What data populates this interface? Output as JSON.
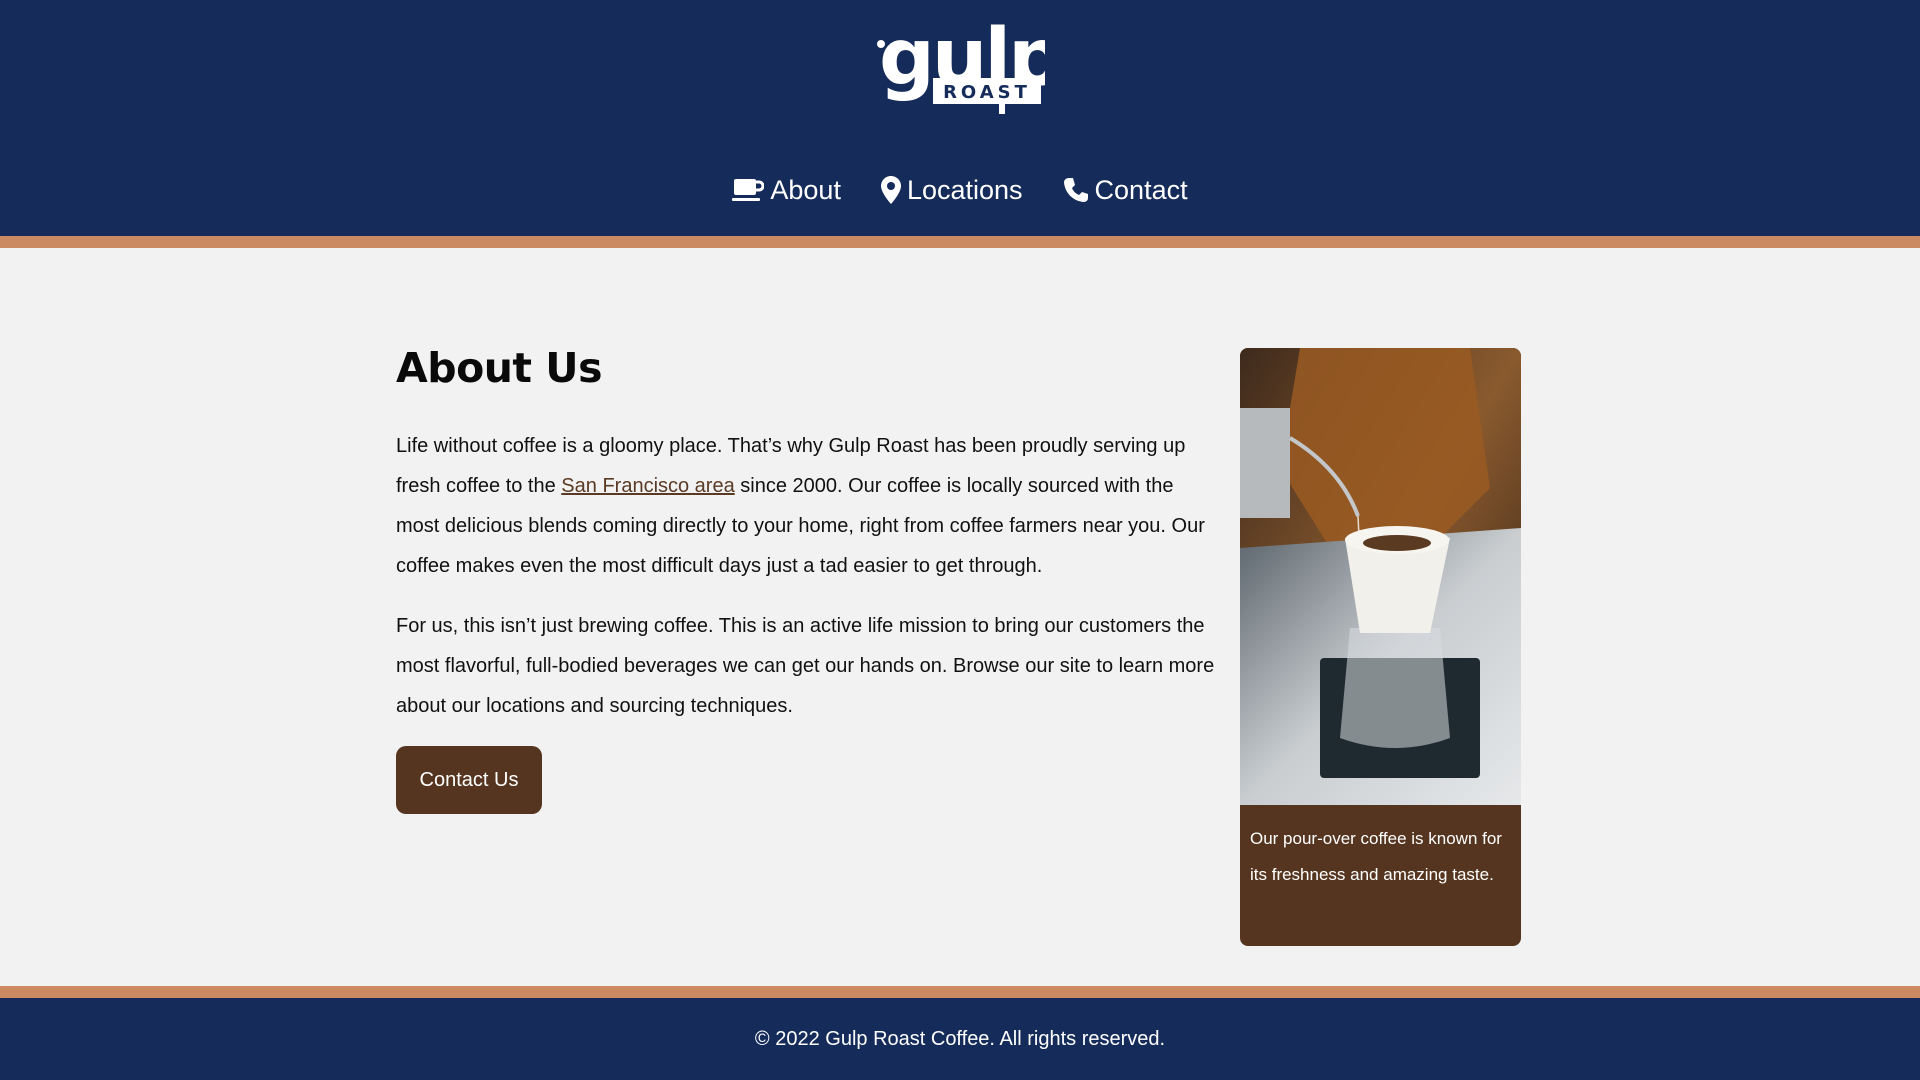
{
  "brand": {
    "logo_word": "gulp",
    "logo_sub": "ROAST"
  },
  "nav": {
    "items": [
      {
        "label": "About",
        "icon": "coffee-cup-icon"
      },
      {
        "label": "Locations",
        "icon": "map-pin-icon"
      },
      {
        "label": "Contact",
        "icon": "phone-icon"
      }
    ]
  },
  "main": {
    "title": "About Us",
    "para1": {
      "before": "Life without coffee is a gloomy place. That’s why Gulp Roast has been proudly serving up fresh coffee to the ",
      "link": "San Francisco area",
      "after": " since 2000. Our coffee is locally sourced with the most delicious blends coming directly to your home, right from coffee farmers near you. Our coffee makes even the most difficult days just a tad easier to get through."
    },
    "para2": "For us, this isn’t just brewing coffee. This is an active life mission to bring our customers the most flavorful, full-bodied beverages we can get our hands on. Browse our site to learn more about our locations and sourcing techniques.",
    "button": "Contact Us"
  },
  "figure": {
    "caption": "Our pour-over coffee is known for its freshness and amazing taste."
  },
  "footer": {
    "copyright": "© 2022 Gulp Roast Coffee. All rights reserved."
  },
  "colors": {
    "navy": "#152b5a",
    "copper": "#cc8a62",
    "brown": "#55351f"
  }
}
